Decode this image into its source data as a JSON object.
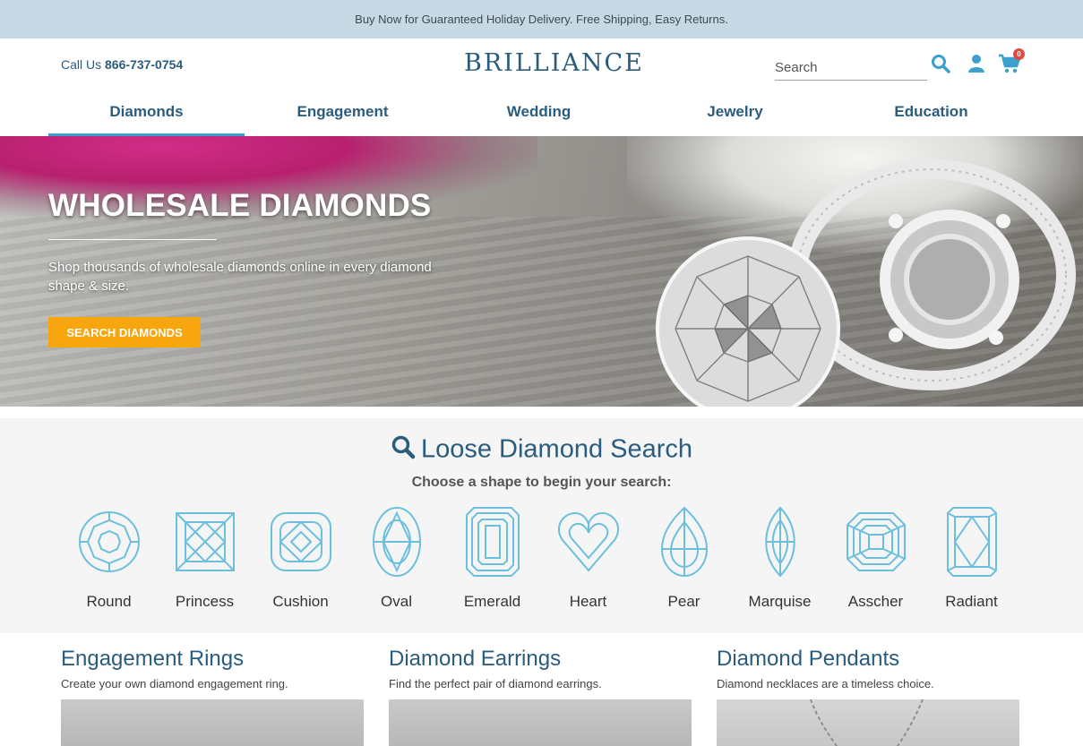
{
  "promo": {
    "text": "Buy Now for Guaranteed Holiday Delivery. Free Shipping, Easy Returns."
  },
  "header": {
    "call_label": "Call Us ",
    "phone": "866-737-0754",
    "logo": "BRILLIANCE",
    "search_placeholder": "Search",
    "cart_count": "0",
    "icons": [
      "search-icon",
      "user-icon",
      "cart-icon"
    ]
  },
  "nav": {
    "items": [
      {
        "label": "Diamonds",
        "active": true
      },
      {
        "label": "Engagement",
        "active": false
      },
      {
        "label": "Wedding",
        "active": false
      },
      {
        "label": "Jewelry",
        "active": false
      },
      {
        "label": "Education",
        "active": false
      }
    ]
  },
  "hero": {
    "title": "WHOLESALE DIAMONDS",
    "subtitle": "Shop thousands of wholesale diamonds online in every diamond shape & size.",
    "button": "SEARCH DIAMONDS"
  },
  "loose": {
    "title": "Loose Diamond Search",
    "subtitle": "Choose a shape to begin your search:",
    "shapes": [
      "Round",
      "Princess",
      "Cushion",
      "Oval",
      "Emerald",
      "Heart",
      "Pear",
      "Marquise",
      "Asscher",
      "Radiant"
    ]
  },
  "cards": [
    {
      "title": "Engagement Rings",
      "text": "Create your own diamond engagement ring."
    },
    {
      "title": "Diamond Earrings",
      "text": "Find the perfect pair of diamond earrings."
    },
    {
      "title": "Diamond Pendants",
      "text": "Diamond necklaces are a timeless choice."
    }
  ],
  "colors": {
    "brand": "#2a5c7e",
    "accent": "#3aa1cf",
    "button": "#f7a60d",
    "promo_bg": "#c7d9e4"
  }
}
